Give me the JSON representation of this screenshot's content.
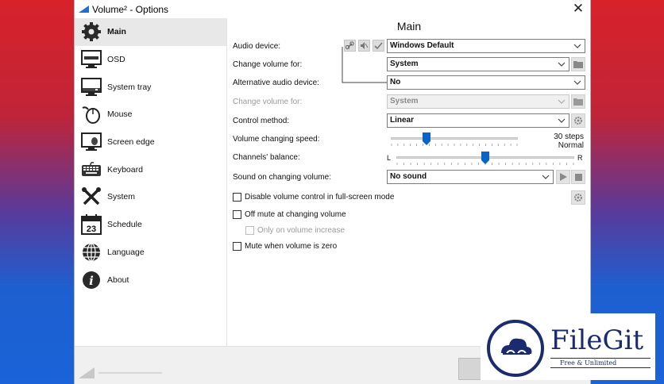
{
  "window": {
    "title": "Volume² - Options",
    "close_glyph": "✕"
  },
  "sidebar": {
    "items": [
      {
        "label": "Main",
        "icon": "gear-icon",
        "active": true
      },
      {
        "label": "OSD",
        "icon": "monitor-icon"
      },
      {
        "label": "System tray",
        "icon": "system-tray-icon"
      },
      {
        "label": "Mouse",
        "icon": "mouse-icon"
      },
      {
        "label": "Screen edge",
        "icon": "screen-edge-icon"
      },
      {
        "label": "Keyboard",
        "icon": "keyboard-icon"
      },
      {
        "label": "System",
        "icon": "tools-icon"
      },
      {
        "label": "Schedule",
        "icon": "calendar-icon",
        "calendar_day": "23"
      },
      {
        "label": "Language",
        "icon": "globe-icon"
      },
      {
        "label": "About",
        "icon": "info-icon",
        "info_glyph": "i"
      }
    ]
  },
  "main": {
    "heading": "Main",
    "audio_device": {
      "label": "Audio device:",
      "value": "Windows Default"
    },
    "change_volume_for": {
      "label": "Change volume for:",
      "value": "System"
    },
    "alt_audio_device": {
      "label": "Alternative audio device:",
      "value": "No"
    },
    "alt_change_volume_for": {
      "label": "Change volume for:",
      "value": "System"
    },
    "control_method": {
      "label": "Control method:",
      "value": "Linear"
    },
    "volume_speed": {
      "label": "Volume changing speed:",
      "steps": "30 steps",
      "mode": "Normal",
      "position": 0.28
    },
    "balance": {
      "label": "Channels' balance:",
      "left": "L",
      "right": "R",
      "position": 0.5
    },
    "sound": {
      "label": "Sound on changing volume:",
      "value": "No sound"
    },
    "checkboxes": {
      "disable_fullscreen": "Disable volume control in full-screen mode",
      "off_mute": "Off mute at changing volume",
      "only_increase": "Only on volume increase",
      "mute_zero": "Mute when volume is zero"
    }
  },
  "watermark": {
    "name": "FileGit",
    "tagline": "Free & Unlimited"
  },
  "colors": {
    "accent": "#0a64c8",
    "brand": "#1a2b6e"
  }
}
